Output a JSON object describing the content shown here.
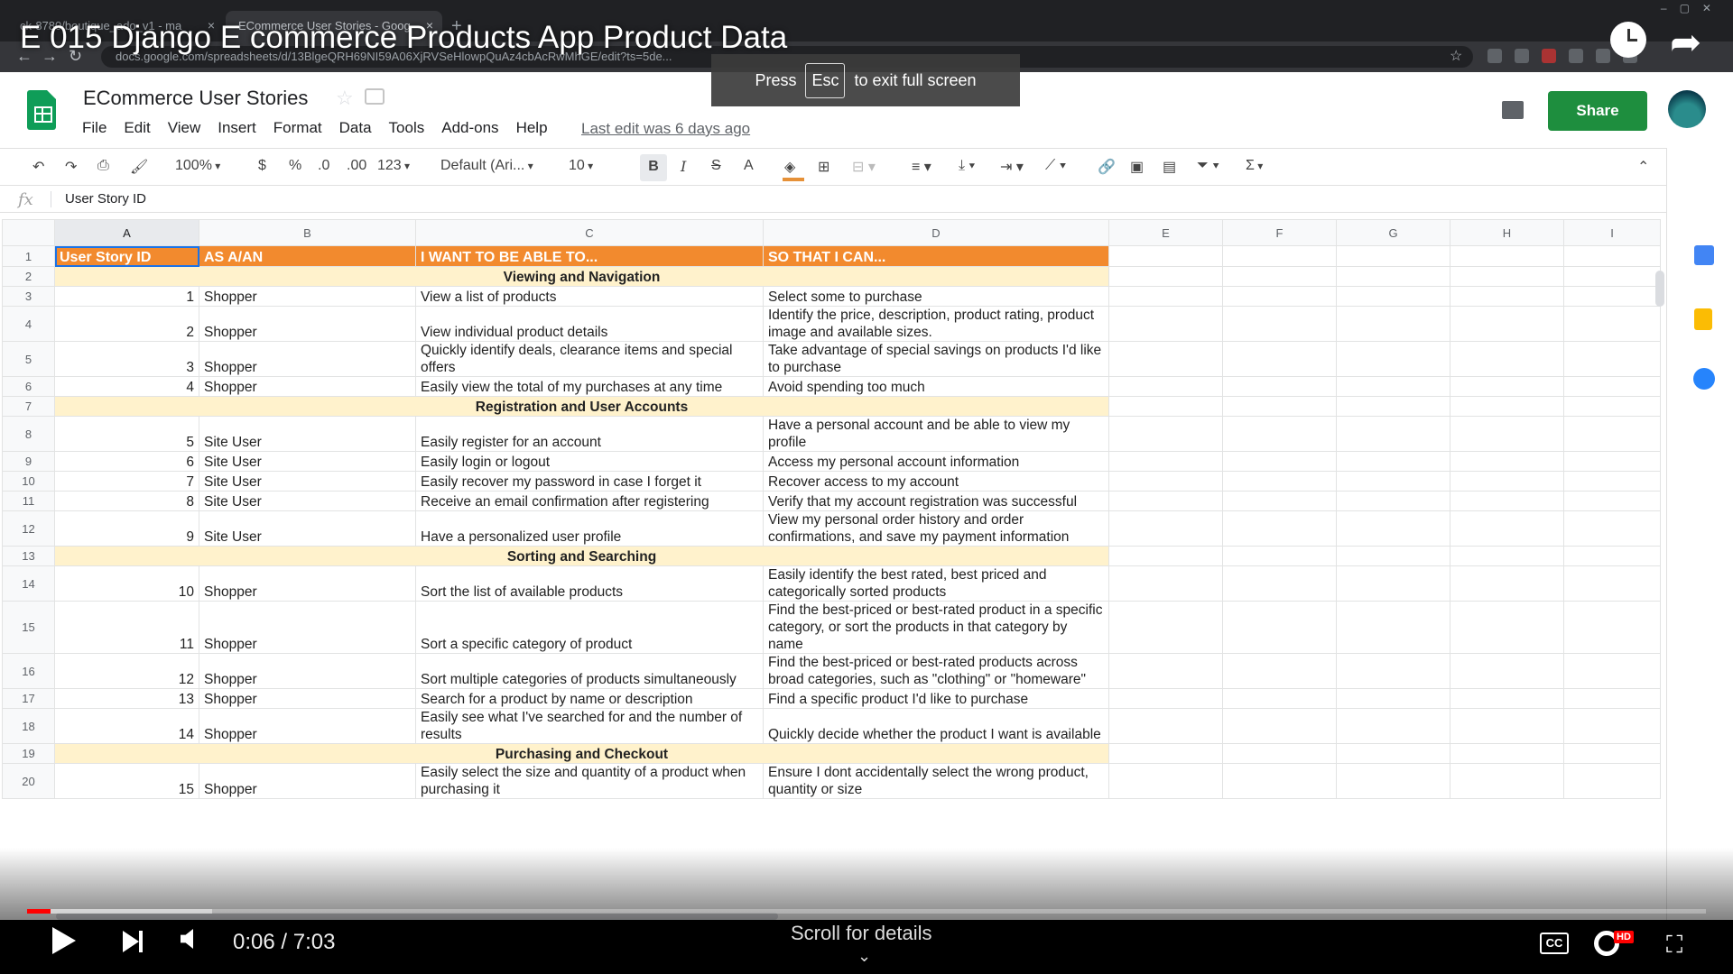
{
  "video": {
    "title": "E 015 Django E commerce Products App Product Data",
    "current_time": "0:06",
    "duration": "7:03",
    "time_display": "0:06 / 7:03",
    "progress_fraction": 0.014,
    "buffered_fraction": 0.11,
    "scroll_hint": "Scroll for details",
    "chevron": "⌄",
    "cc_label": "CC",
    "hd_label": "HD"
  },
  "fullscreen_toast": {
    "press": "Press",
    "key": "Esc",
    "suffix": "to exit full screen"
  },
  "browser": {
    "tabs": [
      {
        "title": "ck-8780/boutique_ado_v1 - ma",
        "active": false
      },
      {
        "title": "ECommerce User Stories - Goog",
        "active": true
      }
    ],
    "url": "docs.google.com/spreadsheets/d/13BlgeQRH69NI59A06XjRVSeHlowpQuAz4cbAcRwMhGE/edit?ts=5de..."
  },
  "app": {
    "title": "ECommerce User Stories",
    "menu": [
      "File",
      "Edit",
      "View",
      "Insert",
      "Format",
      "Data",
      "Tools",
      "Add-ons",
      "Help"
    ],
    "last_edit": "Last edit was 6 days ago",
    "share_label": "Share",
    "toolbar": {
      "zoom": "100%",
      "currency": "$",
      "percent": "%",
      "dec_decrease": ".0",
      "dec_increase": ".00",
      "more_formats": "123",
      "font": "Default (Ari...",
      "font_size": "10",
      "bold": "B",
      "italic": "I",
      "strike": "S",
      "text_color": "A",
      "functions": "Σ"
    },
    "formula_bar": {
      "label": "fx",
      "value": "User Story ID"
    },
    "accent_color": "#f28a2e",
    "section_color": "#fff2cc",
    "share_color": "#1e8e3e"
  },
  "sheet": {
    "columns": [
      "A",
      "B",
      "C",
      "D",
      "E",
      "F",
      "G",
      "H",
      "I"
    ],
    "header": [
      "User Story ID",
      "AS A/AN",
      "I WANT TO BE ABLE TO...",
      "SO THAT I CAN..."
    ],
    "rows": [
      {
        "n": "2",
        "section": "Viewing and Navigation"
      },
      {
        "n": "3",
        "id": "1",
        "role": "Shopper",
        "want": "View a list of products",
        "so": "Select some to purchase"
      },
      {
        "n": "4",
        "id": "2",
        "role": "Shopper",
        "want": "View individual product details",
        "so": "Identify the price, description, product rating, product image and available sizes."
      },
      {
        "n": "5",
        "id": "3",
        "role": "Shopper",
        "want": "Quickly identify deals, clearance items and special offers",
        "so": "Take advantage of special savings on products I'd like to purchase"
      },
      {
        "n": "6",
        "id": "4",
        "role": "Shopper",
        "want": "Easily view the total of my purchases at any time",
        "so": "Avoid spending too much"
      },
      {
        "n": "7",
        "section": "Registration and User Accounts"
      },
      {
        "n": "8",
        "id": "5",
        "role": "Site User",
        "want": "Easily register for an account",
        "so": "Have a personal account and be able to view my profile"
      },
      {
        "n": "9",
        "id": "6",
        "role": "Site User",
        "want": "Easily login or logout",
        "so": "Access my personal account information"
      },
      {
        "n": "10",
        "id": "7",
        "role": "Site User",
        "want": "Easily recover my password in case I forget it",
        "so": "Recover access to my account"
      },
      {
        "n": "11",
        "id": "8",
        "role": "Site User",
        "want": "Receive an email confirmation after registering",
        "so": "Verify that my account registration was successful"
      },
      {
        "n": "12",
        "id": "9",
        "role": "Site User",
        "want": "Have a personalized user profile",
        "so": "View my personal order history and order confirmations, and save my payment information"
      },
      {
        "n": "13",
        "section": "Sorting and Searching"
      },
      {
        "n": "14",
        "id": "10",
        "role": "Shopper",
        "want": "Sort the list of available products",
        "so": "Easily identify the best rated, best priced and categorically sorted products"
      },
      {
        "n": "15",
        "id": "11",
        "role": "Shopper",
        "want": "Sort a specific category of product",
        "so": "Find the best-priced or best-rated product in a specific category, or sort the products in that category by name"
      },
      {
        "n": "16",
        "id": "12",
        "role": "Shopper",
        "want": "Sort multiple categories of products simultaneously",
        "so": "Find the best-priced or best-rated products across broad categories, such as \"clothing\" or \"homeware\""
      },
      {
        "n": "17",
        "id": "13",
        "role": "Shopper",
        "want": "Search for a product by name or description",
        "so": "Find a specific product I'd like to purchase"
      },
      {
        "n": "18",
        "id": "14",
        "role": "Shopper",
        "want": "Easily see what I've searched for and the number of results",
        "so": "Quickly decide whether the product I want is available"
      },
      {
        "n": "19",
        "section": "Purchasing and Checkout"
      },
      {
        "n": "20",
        "id": "15",
        "role": "Shopper",
        "want": "Easily select the size and quantity of a product when purchasing it",
        "so": "Ensure I dont accidentally select the wrong product, quantity or size"
      }
    ]
  }
}
